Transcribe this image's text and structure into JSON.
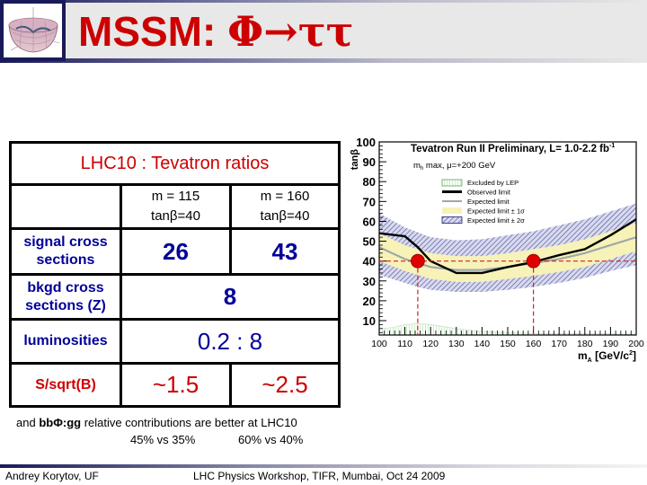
{
  "header": {
    "title_prefix": "MSSM: ",
    "title_phi": "Φ",
    "title_arrow": "→",
    "title_tautau": "ττ",
    "logo": "mexican-hat-potential-icon"
  },
  "table": {
    "title": "LHC10 : Tevatron  ratios",
    "columns": [
      {
        "mass": "m = 115",
        "tanb": "tanβ=40"
      },
      {
        "mass": "m = 160",
        "tanb": "tanβ=40"
      }
    ],
    "rows": [
      {
        "label_line1": "signal cross",
        "label_line2": "sections",
        "values": [
          "26",
          "43"
        ]
      },
      {
        "label_line1": "bkgd cross",
        "label_line2": "sections (Z)",
        "value": "8"
      },
      {
        "label": "luminosities",
        "value": "0.2 : 8"
      },
      {
        "label": "S/sqrt(B)",
        "values": [
          "~1.5",
          "~2.5"
        ]
      }
    ]
  },
  "note": {
    "prefix": "and ",
    "bold": "bbΦ:gg",
    "suffix": " relative contributions are better at LHC10",
    "left_value": "45% vs 35%",
    "right_value": "60% vs 40%"
  },
  "footer": {
    "author": "Andrey Korytov, UF",
    "event": "LHC Physics Workshop, TIFR, Mumbai, Oct 24 2009"
  },
  "chart_data": {
    "type": "line",
    "title": "Tevatron Run II Preliminary, L= 1.0-2.2 fb",
    "title_superscript": "-1",
    "subtitle": "m_h max, μ=+200 GeV",
    "subtitle_main": "m",
    "subtitle_sub": "h",
    "subtitle_rest": " max, μ=+200 GeV",
    "xlabel": "m",
    "xlabel_sub": "A",
    "xlabel_unit": " [GeV/c",
    "xlabel_sup": "2",
    "xlabel_close": "]",
    "ylabel": "tanβ",
    "xlim": [
      100,
      200
    ],
    "ylim": [
      2,
      100
    ],
    "xticks": [
      100,
      110,
      120,
      130,
      140,
      150,
      160,
      170,
      180,
      190,
      200
    ],
    "yticks": [
      10,
      20,
      30,
      40,
      50,
      60,
      70,
      80,
      90,
      100
    ],
    "legend_position": "top-center",
    "legend": [
      {
        "name": "Excluded by LEP",
        "kind": "lep",
        "color": "#7ac77a"
      },
      {
        "name": "Observed limit",
        "kind": "observed",
        "color": "#000000"
      },
      {
        "name": "Expected limit",
        "kind": "expected",
        "color": "#a0a8a8"
      },
      {
        "name": "Expected limit ± 1σ",
        "kind": "band1",
        "color": "#f5f0a8"
      },
      {
        "name": "Expected limit ± 2σ",
        "kind": "band2",
        "color": "#1a1a7a"
      }
    ],
    "x": [
      100,
      110,
      115,
      120,
      130,
      140,
      150,
      160,
      170,
      180,
      190,
      200
    ],
    "series": [
      {
        "name": "Observed limit",
        "values": [
          54,
          52.5,
          47,
          40,
          34,
          34,
          37,
          39.5,
          43,
          46,
          53,
          61
        ]
      },
      {
        "name": "Expected limit",
        "values": [
          47,
          41,
          39,
          37,
          35.5,
          35.5,
          37,
          39,
          41,
          44,
          48,
          52
        ]
      },
      {
        "name": "Expected limit +1σ",
        "values": [
          54,
          48,
          46,
          44,
          42.5,
          42.5,
          44,
          46,
          48,
          51,
          55,
          59
        ]
      },
      {
        "name": "Expected limit -1σ",
        "values": [
          40,
          35,
          33,
          31,
          29.5,
          29.5,
          31,
          32.5,
          34.5,
          37,
          41,
          45
        ]
      },
      {
        "name": "Expected limit +2σ",
        "values": [
          64,
          57,
          54.5,
          52,
          50.5,
          51,
          53,
          55,
          58,
          61,
          65,
          69
        ]
      },
      {
        "name": "Expected limit -2σ",
        "values": [
          33,
          29,
          27,
          25.5,
          24.5,
          24.5,
          25.5,
          27,
          29,
          31.5,
          35,
          38
        ]
      }
    ],
    "lep_excluded": {
      "x": [
        100,
        105,
        110,
        115,
        120,
        130,
        140,
        150,
        160,
        170,
        180,
        190,
        200
      ],
      "values": [
        6,
        6.5,
        8,
        8.5,
        8,
        6,
        4.5,
        4,
        3.5,
        3.5,
        3.5,
        3.3,
        3.2
      ]
    },
    "markers": [
      {
        "x": 115,
        "y": 40,
        "color": "#e00000"
      },
      {
        "x": 160,
        "y": 40,
        "color": "#e00000"
      }
    ],
    "reference_lines": {
      "y": 40,
      "x": [
        115,
        160
      ],
      "color": "#cc2222",
      "style": "dashed"
    }
  }
}
